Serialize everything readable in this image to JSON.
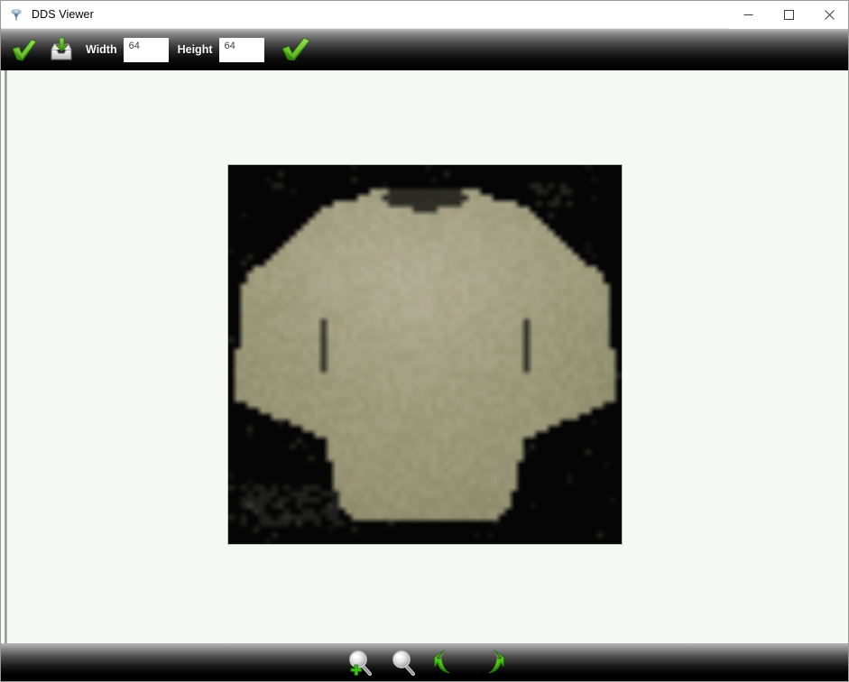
{
  "window": {
    "title": "DDS Viewer",
    "app_icon": "dds-app-icon",
    "controls": {
      "minimize": "minimize-icon",
      "maximize": "maximize-icon",
      "close": "close-icon"
    }
  },
  "toolbar_top": {
    "open_icon": "green-check-open-icon",
    "save_icon": "save-export-icon",
    "width_label": "Width",
    "width_value": "64",
    "width_placeholder": "64",
    "height_label": "Height",
    "height_value": "64",
    "height_placeholder": "64",
    "apply_icon": "green-checkmark-apply-icon"
  },
  "toolbar_bottom": {
    "items": [
      {
        "name": "zoom-in-icon",
        "label": "Zoom In"
      },
      {
        "name": "zoom-out-icon",
        "label": "Zoom Out"
      },
      {
        "name": "rotate-left-icon",
        "label": "Rotate Left"
      },
      {
        "name": "rotate-right-icon",
        "label": "Rotate Right"
      }
    ]
  },
  "viewport": {
    "background_color": "#f5f8f5",
    "image": {
      "name": "dds-texture-preview",
      "description": "Low resolution pullover sweater texture on black background",
      "source_resolution": "64x64",
      "displayed_width": 436,
      "displayed_height": 420,
      "background_color": "#050505",
      "garment_color": "#8d8a6a",
      "garment_highlight": "#b9b49a",
      "garment_shadow": "#5e5c45"
    }
  }
}
